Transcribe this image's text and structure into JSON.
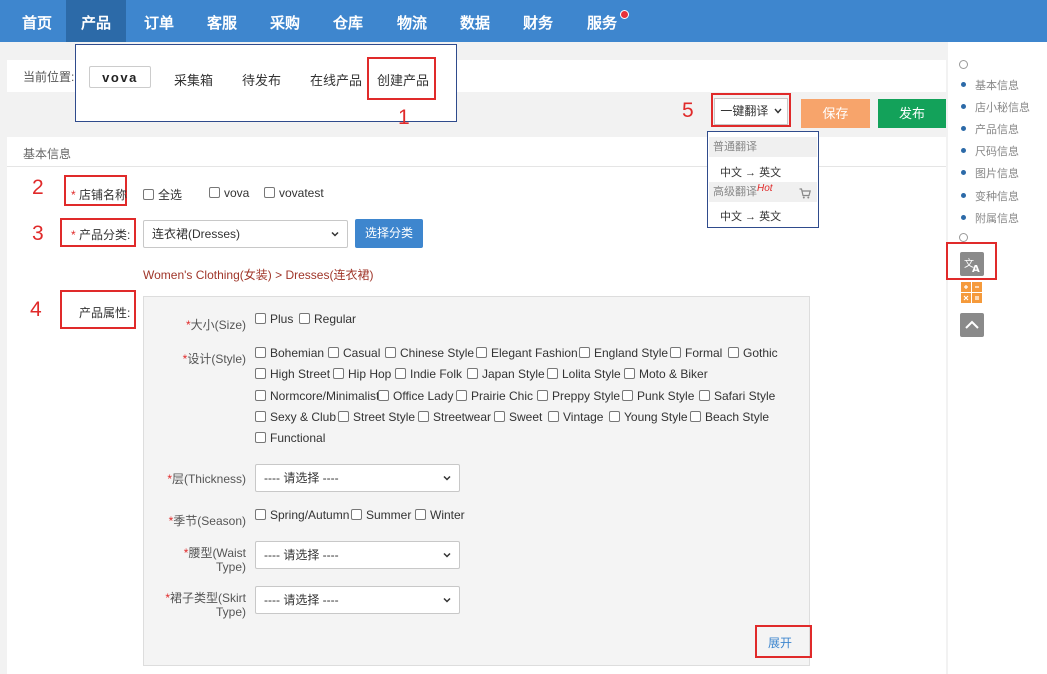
{
  "nav": {
    "items": [
      {
        "label": "首页",
        "active": false
      },
      {
        "label": "产品",
        "active": true
      },
      {
        "label": "订单",
        "active": false
      },
      {
        "label": "客服",
        "active": false
      },
      {
        "label": "采购",
        "active": false
      },
      {
        "label": "仓库",
        "active": false
      },
      {
        "label": "物流",
        "active": false
      },
      {
        "label": "数据",
        "active": false
      },
      {
        "label": "财务",
        "active": false
      },
      {
        "label": "服务",
        "active": false
      }
    ],
    "badge_color": "#e8313a"
  },
  "breadcrumb": {
    "label": "当前位置:",
    "logo": "vova",
    "tabs": [
      "采集箱",
      "待发布",
      "在线产品",
      "创建产品"
    ]
  },
  "annotations": [
    "1",
    "2",
    "3",
    "4",
    "5"
  ],
  "actions": {
    "translate": "一键翻译",
    "save": "保存",
    "publish": "发布"
  },
  "translate_menu": {
    "normal_header": "普通翻译",
    "normal_item": "中文 → 英文",
    "advanced_header": "高级翻译",
    "hot": "Hot",
    "advanced_item": "中文 → 英文"
  },
  "section": {
    "title": "基本信息"
  },
  "form": {
    "store_label": "店铺名称",
    "store_options": [
      "全选",
      "vova",
      "vovatest"
    ],
    "category_label": "产品分类:",
    "category_value": "连衣裙(Dresses)",
    "select_category_btn": "选择分类",
    "category_path": "Women's Clothing(女装)  > Dresses(连衣裙)",
    "attr_label": "产品属性:"
  },
  "attributes": {
    "size": {
      "label": "大小(Size)",
      "options": [
        "Plus",
        "Regular"
      ]
    },
    "style": {
      "label": "设计(Style)",
      "row1": [
        "Bohemian",
        "Casual",
        "Chinese Style",
        "Elegant Fashion",
        "England Style",
        "Formal",
        "Gothic"
      ],
      "row2": [
        "High Street",
        "Hip Hop",
        "Indie Folk",
        "Japan Style",
        "Lolita Style",
        "Moto & Biker"
      ],
      "row3": [
        "Normcore/Minimalist",
        "Office Lady",
        "Prairie Chic",
        "Preppy Style",
        "Punk Style",
        "Safari Style"
      ],
      "row4": [
        "Sexy & Club",
        "Street Style",
        "Streetwear",
        "Sweet",
        "Vintage",
        "Young Style",
        "Beach Style"
      ],
      "row5": [
        "Functional"
      ]
    },
    "thickness": {
      "label": "层(Thickness)",
      "value": "---- 请选择 ----"
    },
    "season": {
      "label": "季节(Season)",
      "options": [
        "Spring/Autumn",
        "Summer",
        "Winter"
      ]
    },
    "waist": {
      "label1": "腰型(Waist",
      "label2": "Type)",
      "value": "---- 请选择 ----"
    },
    "skirt": {
      "label1": "裙子类型(Skirt",
      "label2": "Type)",
      "value": "---- 请选择 ----"
    },
    "expand": "展开"
  },
  "sidebar": {
    "items": [
      "基本信息",
      "店小秘信息",
      "产品信息",
      "尺码信息",
      "图片信息",
      "变种信息",
      "附属信息"
    ]
  },
  "colors": {
    "nav_bg": "#3e86ce",
    "save": "#f7a46b",
    "publish": "#13a25a",
    "annotation_red": "#e02a2a"
  }
}
